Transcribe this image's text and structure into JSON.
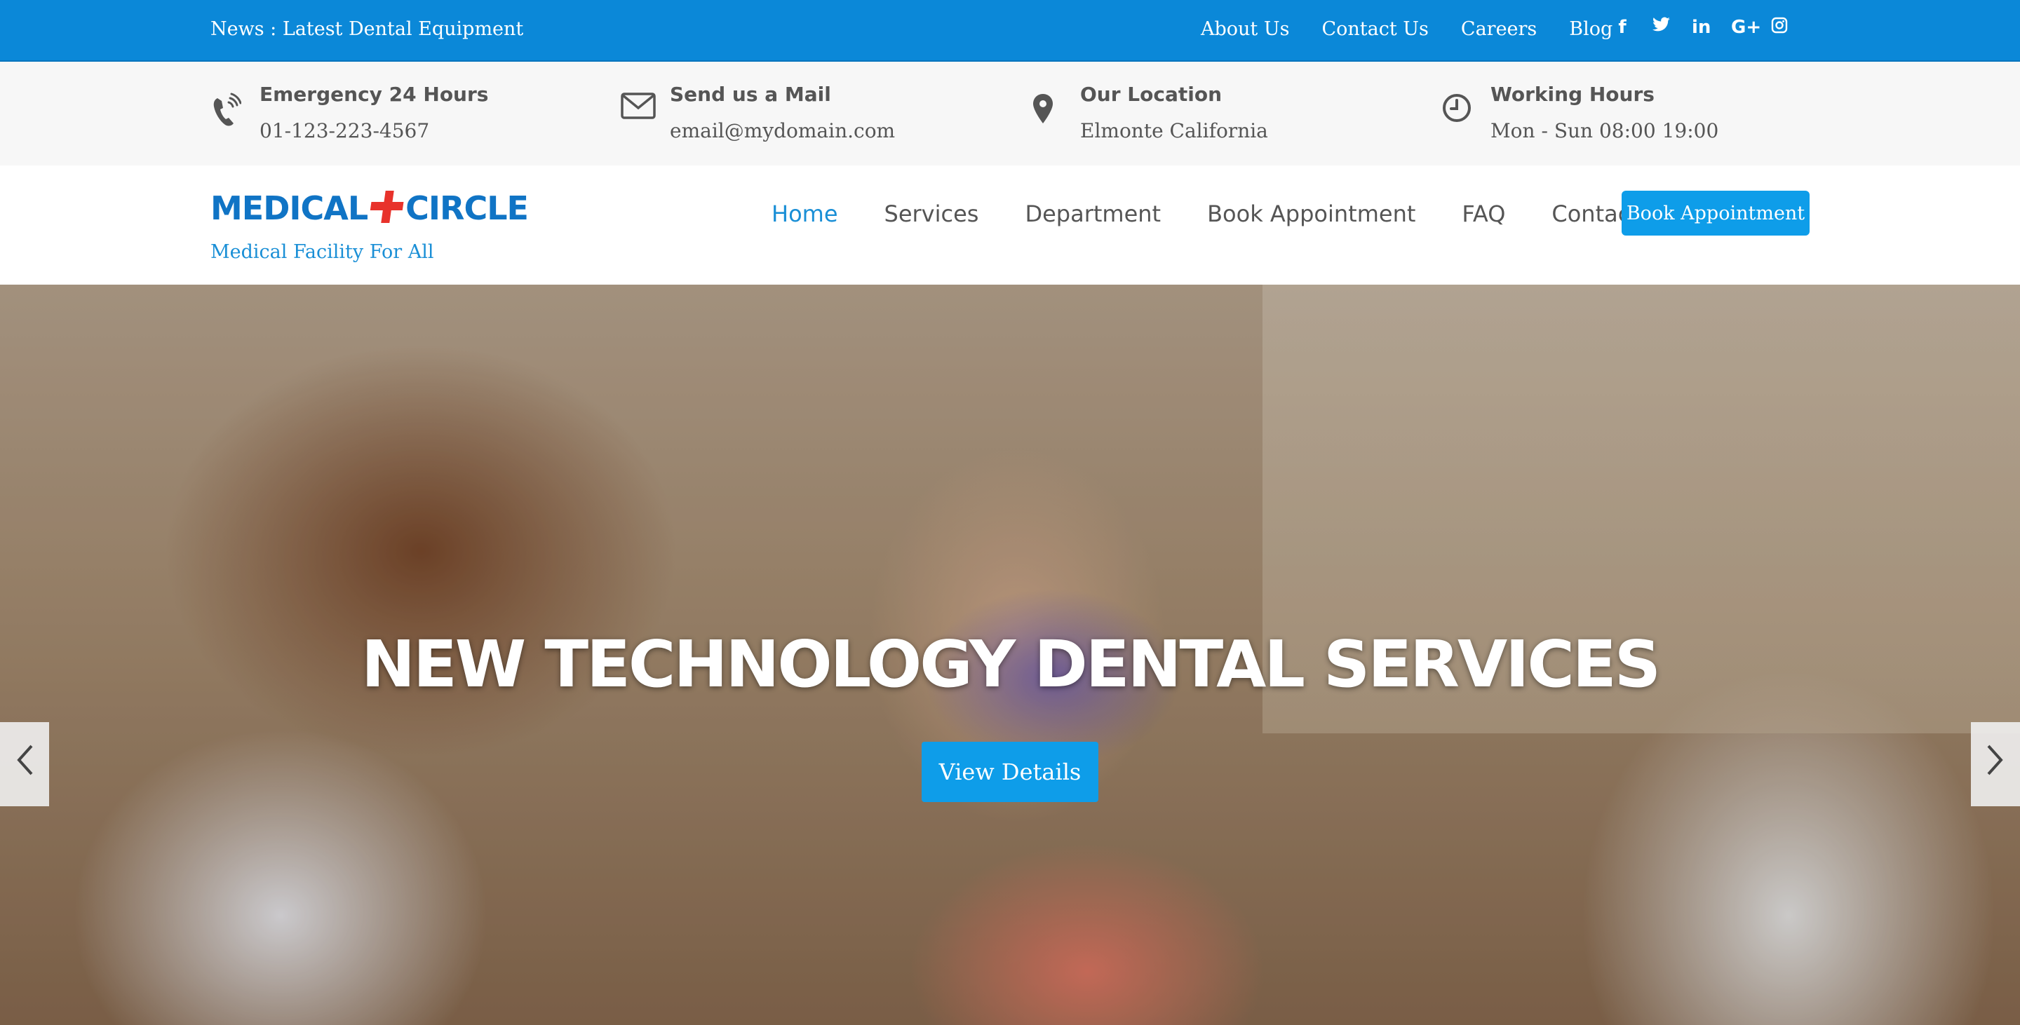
{
  "topbar": {
    "news": "News : Latest Dental Equipment",
    "links": [
      "About Us",
      "Contact Us",
      "Careers",
      "Blog"
    ],
    "social_icons": [
      "facebook-icon",
      "twitter-icon",
      "linkedin-icon",
      "google-plus-icon",
      "instagram-icon"
    ],
    "social_glyphs": [
      "f",
      "t",
      "in",
      "G+",
      "◎"
    ]
  },
  "info": [
    {
      "icon": "phone-icon",
      "title": "Emergency 24 Hours",
      "value": "01-123-223-4567"
    },
    {
      "icon": "mail-icon",
      "title": "Send us a Mail",
      "value": "email@mydomain.com"
    },
    {
      "icon": "location-pin-icon",
      "title": "Our Location",
      "value": "Elmonte California"
    },
    {
      "icon": "clock-icon",
      "title": "Working Hours",
      "value": "Mon - Sun 08:00 19:00"
    }
  ],
  "brand": {
    "logo_left": "MEDICAL",
    "logo_right": "CIRCLE",
    "tagline": "Medical Facility For All",
    "cross_color": "#e8322b",
    "logo_color": "#1074c5"
  },
  "nav": {
    "items": [
      "Home",
      "Services",
      "Department",
      "Book Appointment",
      "FAQ",
      "Contact"
    ],
    "active": "Home",
    "cta": "Book Appointment"
  },
  "hero": {
    "title": "NEW TECHNOLOGY DENTAL SERVICES",
    "button": "View Details",
    "prev_icon": "chevron-left-icon",
    "next_icon": "chevron-right-icon"
  },
  "colors": {
    "primary": "#0b88d8",
    "accent": "#0e9de9",
    "text": "#555555"
  }
}
